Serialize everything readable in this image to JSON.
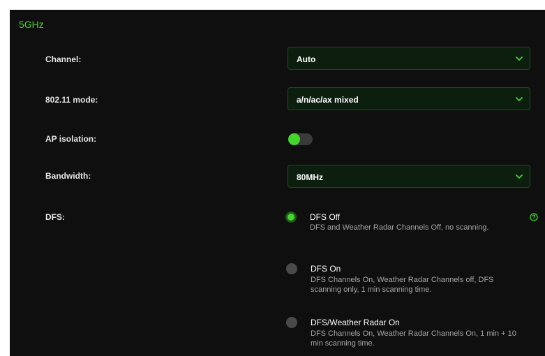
{
  "section": {
    "title": "5GHz"
  },
  "channel": {
    "label": "Channel:",
    "value": "Auto"
  },
  "mode": {
    "label": "802.11 mode:",
    "value": "a/n/ac/ax mixed"
  },
  "ap_isolation": {
    "label": "AP isolation:",
    "state": "on"
  },
  "bandwidth": {
    "label": "Bandwidth:",
    "value": "80MHz"
  },
  "dfs": {
    "label": "DFS:",
    "selected": "DFS Off",
    "options": [
      {
        "title": "DFS Off",
        "desc": "DFS and Weather Radar Channels Off, no scanning."
      },
      {
        "title": "DFS On",
        "desc": "DFS Channels On, Weather Radar Channels off, DFS scanning only, 1 min scanning time."
      },
      {
        "title": "DFS/Weather Radar On",
        "desc": "DFS Channels On, Weather Radar Channels On, 1 min + 10 min scanning time."
      }
    ]
  },
  "icons": {
    "dropdown": "chevron-down-icon",
    "help": "help-circle-icon"
  },
  "colors": {
    "accent": "#44d62c",
    "background": "#0f0f0f",
    "select_bg": "#0c1f0f"
  }
}
